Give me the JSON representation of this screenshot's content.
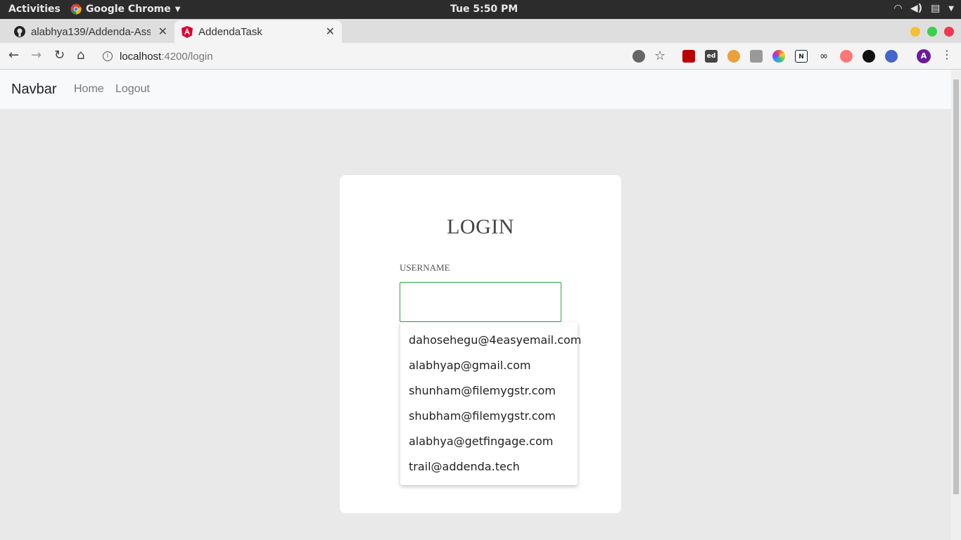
{
  "os_topbar": {
    "activities": "Activities",
    "app_name": "Google Chrome",
    "clock": "Tue  5:50 PM"
  },
  "browser": {
    "tabs": [
      {
        "title": "alabhya139/Addenda-Ass",
        "icon": "github-icon",
        "active": false
      },
      {
        "title": "AddendaTask",
        "icon": "angular-icon",
        "active": true
      }
    ],
    "address": {
      "host": "localhost",
      "path": ":4200/login"
    },
    "profile_initial": "A",
    "ext_ed": "ed",
    "ext_n": "N"
  },
  "navbar": {
    "brand": "Navbar",
    "links": [
      "Home",
      "Logout"
    ]
  },
  "login": {
    "heading": "LOGIN",
    "username_label": "USERNAME",
    "username_value": ""
  },
  "autocomplete": {
    "options": [
      "dahosehegu@4easyemail.com",
      "alabhyap@gmail.com",
      "shunham@filemygstr.com",
      "shubham@filemygstr.com",
      "alabhya@getfingage.com",
      "trail@addenda.tech"
    ]
  },
  "colors": {
    "input_focus_border": "#28a745",
    "page_background": "#e9e9e9",
    "card_background": "#ffffff"
  }
}
